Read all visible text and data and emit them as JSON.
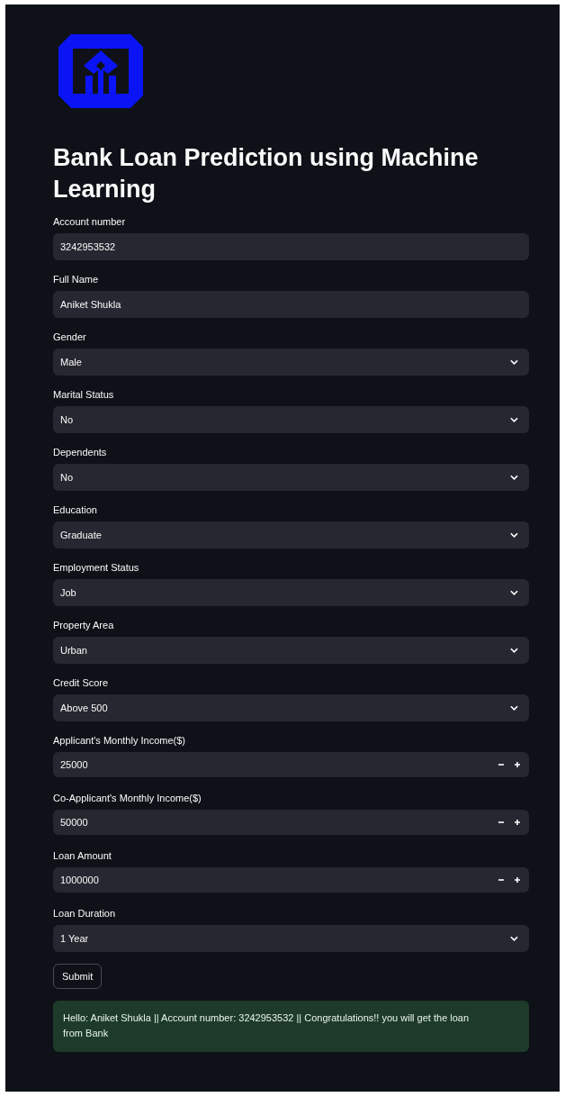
{
  "title": "Bank Loan Prediction using Machine Learning",
  "fields": [
    {
      "kind": "text",
      "label": "Account number",
      "value": "3242953532"
    },
    {
      "kind": "text",
      "label": "Full Name",
      "value": "Aniket Shukla"
    },
    {
      "kind": "select",
      "label": "Gender",
      "value": "Male"
    },
    {
      "kind": "select",
      "label": "Marital Status",
      "value": "No"
    },
    {
      "kind": "select",
      "label": "Dependents",
      "value": "No"
    },
    {
      "kind": "select",
      "label": "Education",
      "value": "Graduate"
    },
    {
      "kind": "select",
      "label": "Employment Status",
      "value": "Job"
    },
    {
      "kind": "select",
      "label": "Property Area",
      "value": "Urban"
    },
    {
      "kind": "select",
      "label": "Credit Score",
      "value": "Above 500"
    },
    {
      "kind": "number",
      "label": "Applicant's Monthly Income($)",
      "value": "25000"
    },
    {
      "kind": "number",
      "label": "Co-Applicant's Monthly Income($)",
      "value": "50000"
    },
    {
      "kind": "number",
      "label": "Loan Amount",
      "value": "1000000"
    },
    {
      "kind": "select",
      "label": "Loan Duration",
      "value": "1 Year"
    }
  ],
  "submit": "Submit",
  "result": "Hello: Aniket Shukla || Account number: 3242953532 || Congratulations!! you will get the loan from Bank"
}
